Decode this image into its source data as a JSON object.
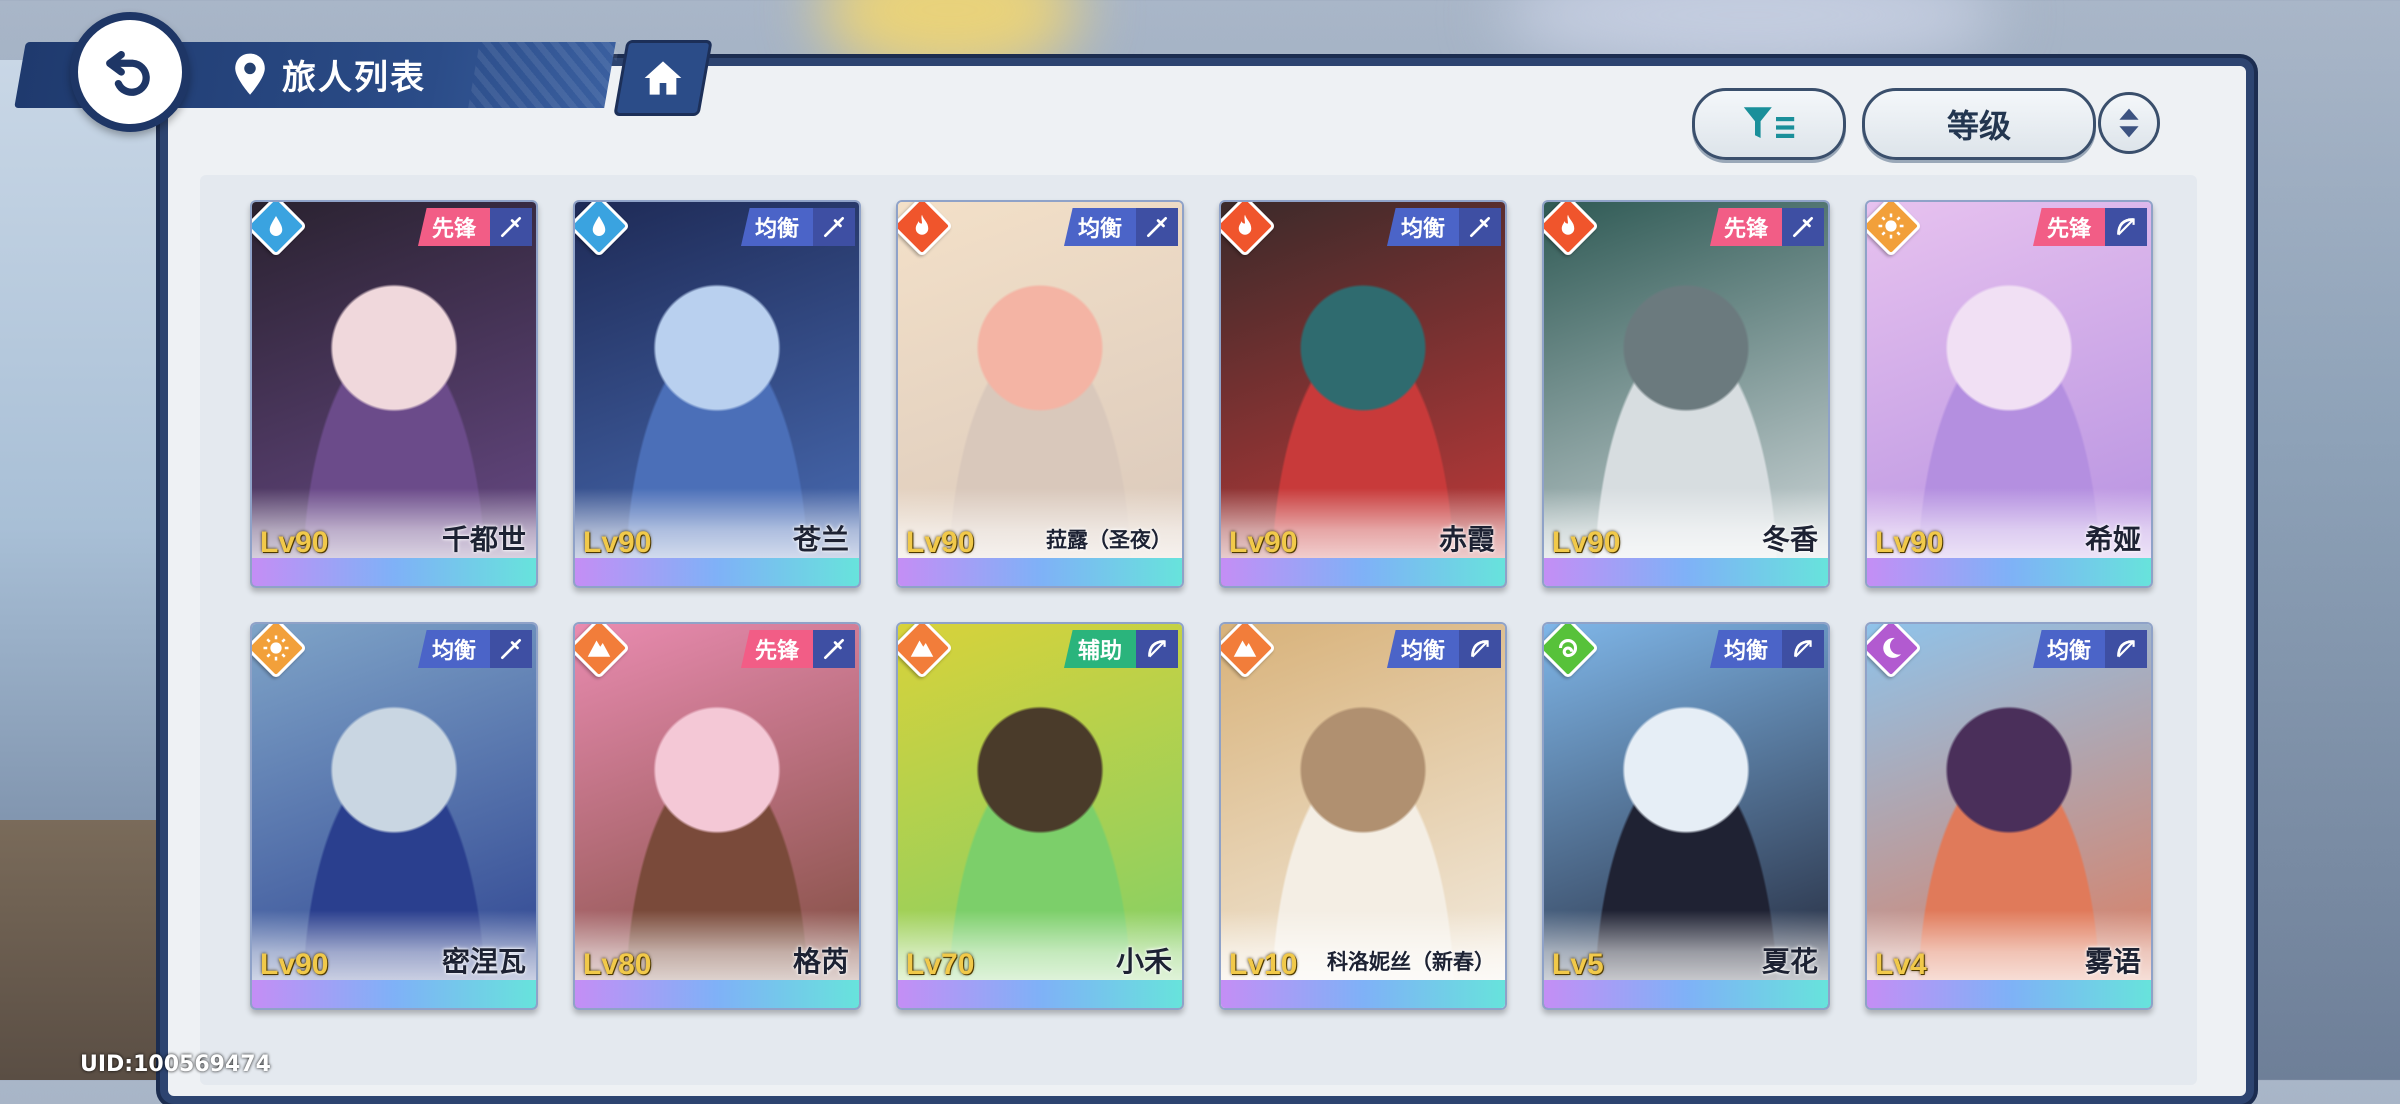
{
  "header": {
    "title": "旅人列表"
  },
  "toolbar": {
    "sort_label": "等级"
  },
  "uid_text": "UID:100569474",
  "colors": {
    "vanguard": "#f25d86",
    "balance": "#4b64c8",
    "support": "#2ab47c",
    "water": "#3aa3e0",
    "fire": "#f0552c",
    "sun": "#f2a03a",
    "earth": "#f27d3a",
    "wind": "#57c23a",
    "moon": "#b25ad0"
  },
  "travelers": [
    {
      "name": "千都世",
      "level": "Lv90",
      "role": "先锋",
      "element": "water",
      "weapon": "sword",
      "art": [
        "#2a2230",
        "#6b4b8a",
        "#f0d8dc"
      ]
    },
    {
      "name": "苍兰",
      "level": "Lv90",
      "role": "均衡",
      "element": "water",
      "weapon": "sword",
      "art": [
        "#1e2a56",
        "#4b6fb8",
        "#b9d0ef"
      ]
    },
    {
      "name": "菈露（圣夜）",
      "level": "Lv90",
      "role": "均衡",
      "element": "fire",
      "weapon": "sword",
      "art": [
        "#f3e0c8",
        "#d9c8bb",
        "#f4b4a4"
      ]
    },
    {
      "name": "赤霞",
      "level": "Lv90",
      "role": "均衡",
      "element": "fire",
      "weapon": "sword",
      "art": [
        "#3b2a2a",
        "#c83a3a",
        "#2f6b6f"
      ]
    },
    {
      "name": "冬香",
      "level": "Lv90",
      "role": "先锋",
      "element": "fire",
      "weapon": "sword",
      "art": [
        "#2f5a55",
        "#d7dde0",
        "#6b7a7e"
      ]
    },
    {
      "name": "希娅",
      "level": "Lv90",
      "role": "先锋",
      "element": "sun",
      "weapon": "bow",
      "art": [
        "#e7c2ef",
        "#b48fe0",
        "#f1e0f4"
      ]
    },
    {
      "name": "密涅瓦",
      "level": "Lv90",
      "role": "均衡",
      "element": "sun",
      "weapon": "sword",
      "art": [
        "#7fa4c8",
        "#2a3f8e",
        "#c9d6e2"
      ]
    },
    {
      "name": "格芮",
      "level": "Lv80",
      "role": "先锋",
      "element": "earth",
      "weapon": "sword",
      "art": [
        "#e98bb0",
        "#7a4a3a",
        "#f4c8d6"
      ]
    },
    {
      "name": "小禾",
      "level": "Lv70",
      "role": "辅助",
      "element": "earth",
      "weapon": "bow",
      "art": [
        "#d8d23a",
        "#7ccf6a",
        "#4a3b2a"
      ]
    },
    {
      "name": "科洛妮丝（新春）",
      "level": "Lv10",
      "role": "均衡",
      "element": "earth",
      "weapon": "bow",
      "art": [
        "#d8b27a",
        "#f4eee4",
        "#b09070"
      ]
    },
    {
      "name": "夏花",
      "level": "Lv5",
      "role": "均衡",
      "element": "wind",
      "weapon": "bow",
      "art": [
        "#7fb6e8",
        "#1f2233",
        "#e6eef6"
      ]
    },
    {
      "name": "雾语",
      "level": "Lv4",
      "role": "均衡",
      "element": "moon",
      "weapon": "bow",
      "art": [
        "#8fc3ea",
        "#e07a5a",
        "#4a2f5a"
      ]
    }
  ]
}
